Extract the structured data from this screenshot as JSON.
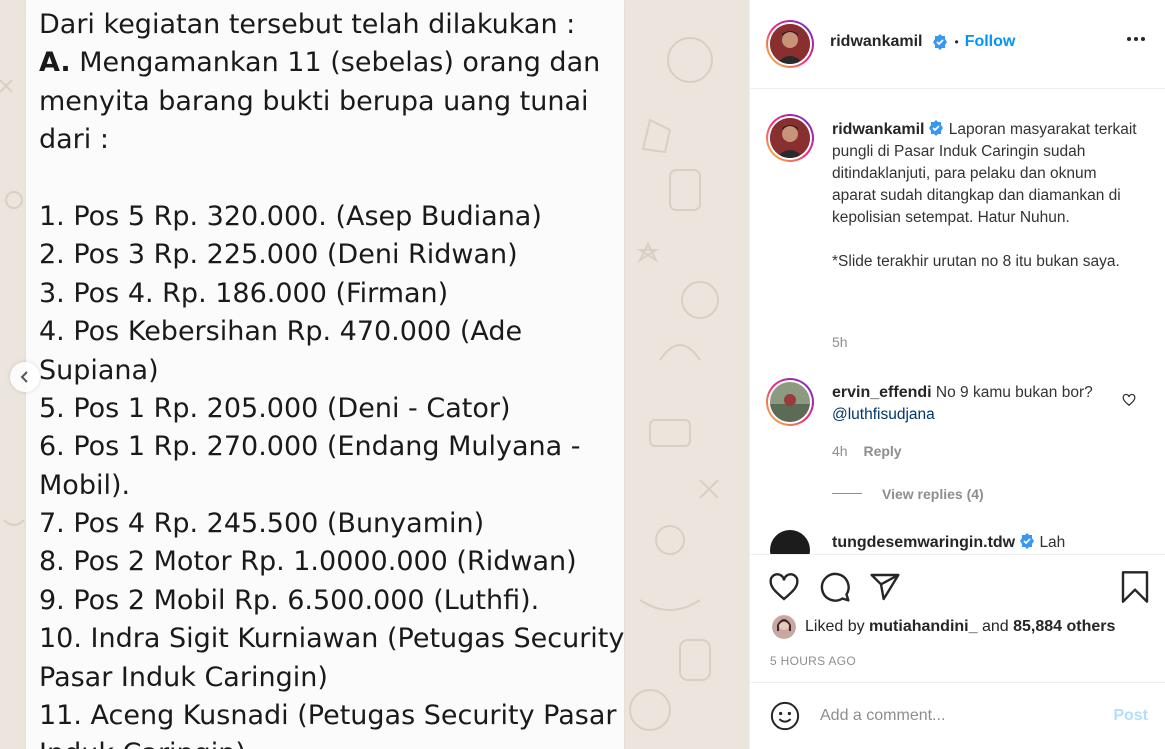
{
  "post": {
    "message_lines": [
      {
        "text": "Dari kegiatan tersebut telah dilakukan :",
        "bold_prefix": ""
      },
      {
        "text": " Mengamankan 11 (sebelas) orang dan",
        "bold_prefix": "A."
      },
      {
        "text": "menyita barang bukti berupa uang tunai",
        "bold_prefix": ""
      },
      {
        "text": "dari :",
        "bold_prefix": ""
      },
      {
        "text": "",
        "bold_prefix": ""
      },
      {
        "text": "1. Pos 5 Rp. 320.000. (Asep Budiana)",
        "bold_prefix": ""
      },
      {
        "text": "2. Pos 3 Rp. 225.000 (Deni Ridwan)",
        "bold_prefix": ""
      },
      {
        "text": "3. Pos 4. Rp. 186.000 (Firman)",
        "bold_prefix": ""
      },
      {
        "text": "4. Pos Kebersihan Rp. 470.000 (Ade",
        "bold_prefix": ""
      },
      {
        "text": "Supiana)",
        "bold_prefix": ""
      },
      {
        "text": "5. Pos 1 Rp. 205.000 (Deni - Cator)",
        "bold_prefix": ""
      },
      {
        "text": "6. Pos 1 Rp. 270.000 (Endang Mulyana -",
        "bold_prefix": ""
      },
      {
        "text": "Mobil).",
        "bold_prefix": ""
      },
      {
        "text": "7. Pos 4 Rp. 245.500 (Bunyamin)",
        "bold_prefix": ""
      },
      {
        "text": "8. Pos 2 Motor Rp. 1.0000.000 (Ridwan)",
        "bold_prefix": ""
      },
      {
        "text": "9. Pos 2 Mobil Rp. 6.500.000 (Luthfi).",
        "bold_prefix": ""
      },
      {
        "text": "10. Indra Sigit Kurniawan (Petugas Security",
        "bold_prefix": ""
      },
      {
        "text": "Pasar Induk Caringin)",
        "bold_prefix": ""
      },
      {
        "text": "11. Aceng Kusnadi (Petugas Security Pasar",
        "bold_prefix": ""
      },
      {
        "text": "Induk Caringin)",
        "bold_prefix": ""
      }
    ]
  },
  "header": {
    "username": "ridwankamil",
    "separator": "•",
    "follow_label": "Follow"
  },
  "caption": {
    "username": "ridwankamil",
    "text": "Laporan masyarakat terkait pungli di Pasar Induk Caringin sudah ditindaklanjuti, para pelaku dan oknum aparat sudah ditangkap dan diamankan di kepolisian setempat. Hatur Nuhun.",
    "text2": "*Slide terakhir urutan no 8 itu bukan saya.",
    "age": "5h"
  },
  "comments": [
    {
      "username": "ervin_effendi",
      "text": "No 9 kamu bukan bor?",
      "mention": "@luthfisudjana",
      "age": "4h",
      "reply_label": "Reply",
      "view_replies": "View replies (4)"
    },
    {
      "username": "tungdesemwaringin.tdw",
      "text": "Lah"
    }
  ],
  "likes": {
    "prefix": "Liked by",
    "user": "mutiahandini_",
    "middle": "and",
    "count": "85,884 others"
  },
  "timestamp": "5 HOURS AGO",
  "add_comment": {
    "placeholder": "Add a comment...",
    "post_label": "Post"
  },
  "colors": {
    "link": "#0095f6",
    "verified": "#3897f0",
    "muted": "#8e8e8e",
    "chat_bg": "#ece5dd",
    "bubble": "#fbfbfb"
  },
  "icons": [
    "verified-badge-icon",
    "more-options-icon",
    "heart-icon",
    "comment-icon",
    "share-icon",
    "bookmark-icon",
    "emoji-icon",
    "chevron-left-icon"
  ]
}
